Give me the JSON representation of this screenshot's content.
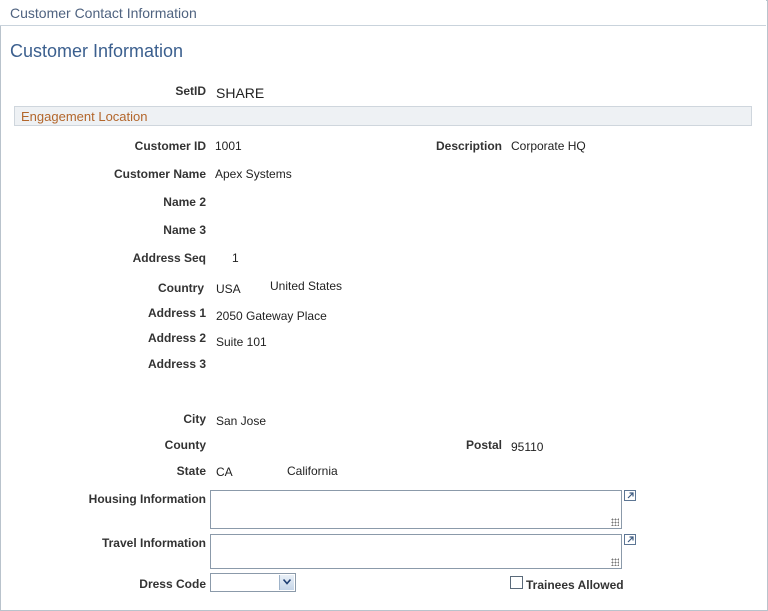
{
  "window": {
    "title": "Customer Contact Information"
  },
  "page": {
    "heading": "Customer Information"
  },
  "setid": {
    "label": "SetID",
    "value": "SHARE"
  },
  "group": {
    "title": "Engagement Location"
  },
  "fields": {
    "customer_id": {
      "label": "Customer ID",
      "value": "1001"
    },
    "description": {
      "label": "Description",
      "value": "Corporate HQ"
    },
    "customer_name": {
      "label": "Customer Name",
      "value": "Apex Systems"
    },
    "name2": {
      "label": "Name 2",
      "value": ""
    },
    "name3": {
      "label": "Name 3",
      "value": ""
    },
    "address_seq": {
      "label": "Address Seq",
      "value": "1"
    },
    "country": {
      "label": "Country",
      "code": "USA",
      "name": "United States"
    },
    "address1": {
      "label": "Address 1",
      "value": "2050 Gateway Place"
    },
    "address2": {
      "label": "Address 2",
      "value": "Suite 101"
    },
    "address3": {
      "label": "Address 3",
      "value": ""
    },
    "city": {
      "label": "City",
      "value": "San Jose"
    },
    "county": {
      "label": "County",
      "value": ""
    },
    "postal": {
      "label": "Postal",
      "value": "95110"
    },
    "state": {
      "label": "State",
      "code": "CA",
      "name": "California"
    },
    "housing_info": {
      "label": "Housing Information",
      "value": ""
    },
    "travel_info": {
      "label": "Travel Information",
      "value": ""
    },
    "dress_code": {
      "label": "Dress Code",
      "selected": ""
    },
    "trainees_allowed": {
      "label": "Trainees Allowed",
      "checked": false
    }
  },
  "icons": {
    "expand": "expand-icon",
    "dropdown": "chevron-down-icon",
    "resize": "resize-grip-icon"
  },
  "colors": {
    "heading": "#3b5f8e",
    "group_title": "#b3662b",
    "label": "#333333"
  }
}
